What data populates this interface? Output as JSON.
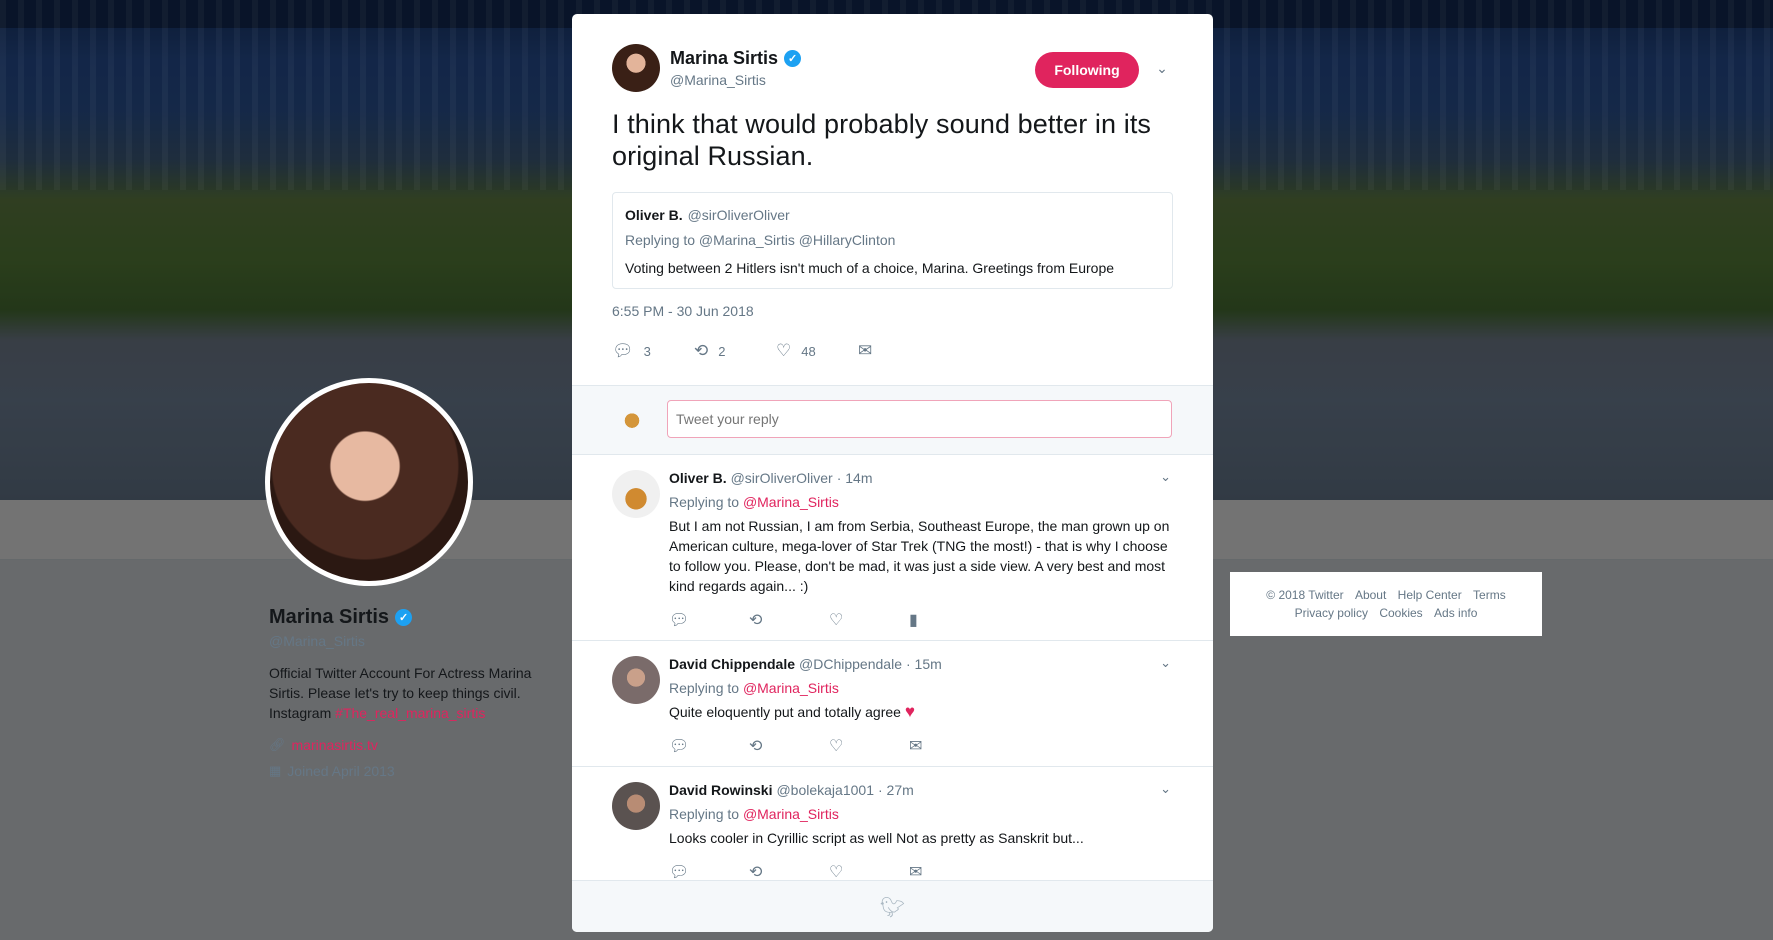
{
  "profile": {
    "name": "Marina Sirtis",
    "handle": "@Marina_Sirtis",
    "bio_line1": "Official Twitter Account For Actress Marina Sirtis. Please let's try to keep things civil. Instagram ",
    "bio_tag": "#The_real_marina_sirtis",
    "website": "marinasirtis.tv",
    "joined": "Joined April 2013"
  },
  "footer": {
    "links": [
      "© 2018 Twitter",
      "About",
      "Help Center",
      "Terms",
      "Privacy policy",
      "Cookies",
      "Ads info"
    ]
  },
  "tweet": {
    "author_name": "Marina Sirtis",
    "author_handle": "@Marina_Sirtis",
    "follow_label": "Following",
    "text": "I think that would probably sound better in its original Russian.",
    "quote": {
      "name": "Oliver B.",
      "handle": "@sirOliverOliver",
      "replying": "Replying to @Marina_Sirtis @HillaryClinton",
      "text": "Voting between 2 Hitlers isn't much of a choice, Marina. Greetings from Europe"
    },
    "timestamp": "6:55 PM - 30 Jun 2018",
    "counts": {
      "replies": "3",
      "retweets": "2",
      "likes": "48"
    }
  },
  "reply_box": {
    "placeholder": "Tweet your reply"
  },
  "replies": [
    {
      "name": "Oliver B.",
      "handle": "@sirOliverOliver",
      "time": "· 14m",
      "replying_prefix": "Replying to ",
      "mention": "@Marina_Sirtis",
      "text": "But I am not Russian, I am from Serbia, Southeast Europe, the man grown up on American culture, mega-lover of Star Trek (TNG the most!) - that is why I choose to follow you. Please, don't be mad, it was just a side view. A very best and most kind regards again... :)"
    },
    {
      "name": "David Chippendale",
      "handle": "@DChippendale",
      "time": "· 15m",
      "replying_prefix": "Replying to ",
      "mention": "@Marina_Sirtis",
      "text": "Quite eloquently put and totally agree "
    },
    {
      "name": "David Rowinski",
      "handle": "@bolekaja1001",
      "time": "· 27m",
      "replying_prefix": "Replying to ",
      "mention": "@Marina_Sirtis",
      "text": "Looks cooler in Cyrillic script as well Not as pretty as Sanskrit but..."
    }
  ],
  "colors": {
    "accent": "#e0245e",
    "verified": "#1da1f2",
    "muted": "#657786"
  }
}
